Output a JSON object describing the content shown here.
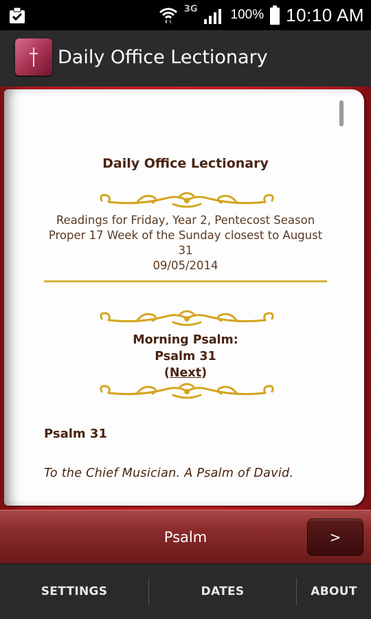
{
  "status_bar": {
    "network": "3G",
    "battery_percent": "100%",
    "time": "10:10 AM"
  },
  "app_bar": {
    "title": "Daily Office Lectionary",
    "icon": "bible-icon"
  },
  "content": {
    "doc_title": "Daily Office Lectionary",
    "reading_line1": "Readings for Friday, Year 2, Pentecost Season",
    "reading_line2": "Proper 17 Week of the Sunday closest to August",
    "reading_line3": "31",
    "reading_date": "09/05/2014",
    "section_heading": "Morning Psalm:",
    "section_value": "Psalm 31",
    "next_link": "Next",
    "psalm_title": "Psalm 31",
    "psalm_superscription": "To the Chief Musician. A Psalm of David."
  },
  "psalm_bar": {
    "label": "Psalm",
    "next_button": ">"
  },
  "tabs": [
    {
      "label": "SETTINGS"
    },
    {
      "label": "DATES"
    },
    {
      "label": "ABOUT"
    }
  ],
  "colors": {
    "book_red": "#c81d24",
    "gold": "#d6b23a",
    "text_brown": "#4a2410"
  }
}
